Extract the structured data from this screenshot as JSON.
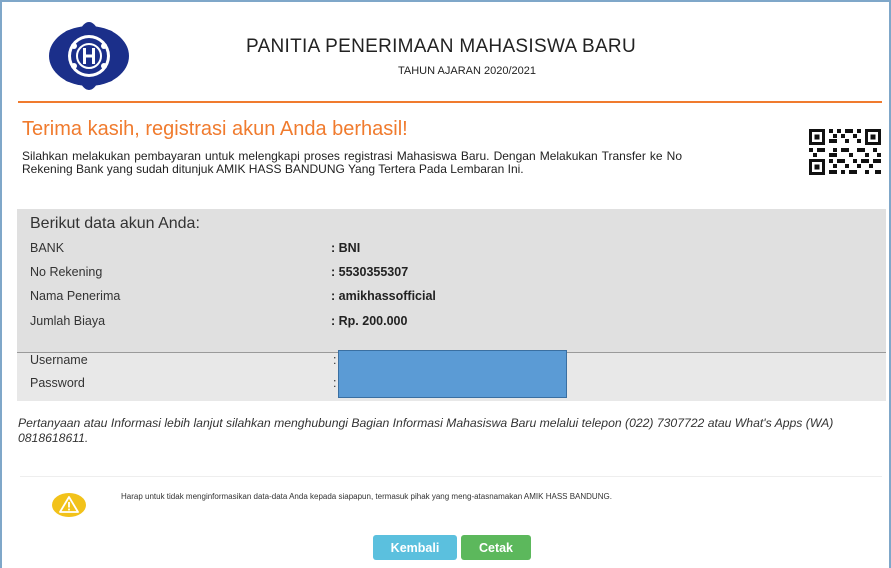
{
  "header": {
    "title": "PANITIA PENERIMAAN MAHASISWA BARU",
    "subtitle": "TAHUN AJARAN 2020/2021",
    "logo_icon": "university-seal-icon",
    "logo_color": "#1b2f8a"
  },
  "success": {
    "title": "Terima kasih, registrasi akun Anda berhasil!",
    "message": "Silahkan melakukan pembayaran untuk melengkapi proses registrasi Mahasiswa Baru. Dengan Melakukan Transfer ke No Rekening Bank yang sudah ditunjuk AMIK HASS BANDUNG Yang Tertera Pada Lembaran Ini.",
    "qr_icon": "qr-code-icon"
  },
  "account": {
    "heading": "Berikut data akun Anda:",
    "rows": [
      {
        "label": "BANK",
        "value": ": BNI"
      },
      {
        "label": "No Rekening",
        "value": ": 5530355307"
      },
      {
        "label": "Nama Penerima",
        "value": ": amikhassofficial"
      },
      {
        "label": "Jumlah Biaya",
        "value": ": Rp. 200.000"
      }
    ],
    "username_label": "Username",
    "password_label": "Password",
    "colon": ":"
  },
  "contact_text": "Pertanyaan atau Informasi lebih lanjut silahkan menghubungi Bagian Informasi Mahasiswa Baru melalui telepon (022) 7307722 atau What's Apps (WA) 0818618611.",
  "warning": {
    "icon": "warning-icon",
    "text": "Harap untuk tidak menginformasikan data-data Anda kepada siapapun, termasuk pihak yang meng-atasnamakan AMIK HASS BANDUNG."
  },
  "buttons": {
    "back_label": "Kembali",
    "print_label": "Cetak"
  },
  "colors": {
    "accent_orange": "#f07b2e",
    "redaction_blue": "#5b9bd5",
    "info_button": "#5bc0de",
    "success_button": "#5cb85c"
  }
}
